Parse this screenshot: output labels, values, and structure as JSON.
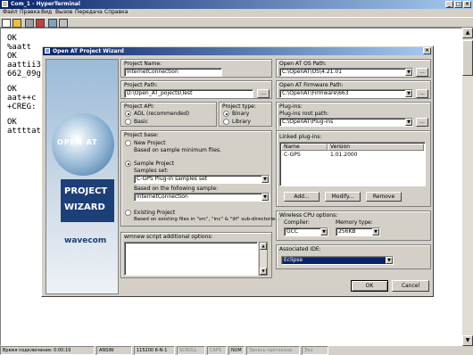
{
  "app": {
    "title": "Com_1 - HyperTerminal",
    "menu": [
      "Файл",
      "Правка",
      "Вид",
      "Вызов",
      "Передача",
      "Справка"
    ]
  },
  "terminal": {
    "lines": [
      "OK",
      "%aatt",
      "OK",
      "aattii3",
      "662_09g",
      "",
      "OK",
      "aat++c",
      "+CREG:",
      "",
      "OK",
      "attttat"
    ]
  },
  "status_bar": {
    "cells": [
      "Время подключения: 0:00:19",
      "ANSIW",
      "115200 8-N-1",
      "SCROLL",
      "CAPS",
      "NUM",
      "Запись протокола",
      "Эхо"
    ]
  },
  "wizard": {
    "title": "Open AT Project Wizard",
    "side_panel": {
      "open_at": "OPEN AT",
      "project": "PROJECT",
      "wizard": "WIZARD",
      "brand": "wavecom"
    },
    "project_name": {
      "label": "Project Name:",
      "value": "InternetConnection"
    },
    "project_path": {
      "label": "Project Path:",
      "value": "D:\\Open_AT_pojects\\Test",
      "browse": "..."
    },
    "project_api": {
      "label": "Project API:",
      "options": [
        "ADL (recommended)",
        "Basic"
      ],
      "selected": 0
    },
    "project_type": {
      "label": "Project type:",
      "options": [
        "Binary",
        "Library"
      ],
      "selected": 0
    },
    "project_base": {
      "label": "Project base:",
      "new_project": "New Project",
      "new_desc": "Based on sample minimum files.",
      "sample_project": "Sample Project",
      "samples_set_label": "Samples set:",
      "samples_set_value": "C-GPS Plug-in samples set",
      "following_sample_label": "Based on the following sample:",
      "following_sample_value": "InternetConnection",
      "existing_project": "Existing Project",
      "existing_desc": "Based on existing files in \"src\", \"inc\" & \"itf\" sub-directories.",
      "selected": 1
    },
    "wmnew": {
      "label": "wmnew script additional options:"
    },
    "os_path": {
      "label": "Open AT OS Path:",
      "value": "C:\\OpenAT\\OS\\4.21.01",
      "browse": "..."
    },
    "fw_path": {
      "label": "Open AT Firmware Path:",
      "value": "C:\\OpenAT\\Firmware\\663",
      "browse": "..."
    },
    "plugins": {
      "label": "Plug-ins:",
      "root_label": "Plug-ins root path:",
      "root_value": "C:\\OpenAT\\Plug-ins",
      "browse": "...",
      "linked_label": "Linked plug-ins:",
      "columns": [
        "Name",
        "Version"
      ],
      "rows": [
        {
          "name": "C-GPS",
          "version": "1.01.2000"
        }
      ],
      "add": "Add...",
      "modify": "Modify...",
      "remove": "Remove"
    },
    "cpu": {
      "label": "Wireless CPU options:",
      "compiler_label": "Compiler:",
      "compiler_value": "GCC",
      "memory_label": "Memory type:",
      "memory_value": "256KB"
    },
    "ide": {
      "label": "Associated IDE:",
      "value": "Eclipse"
    },
    "ok": "OK",
    "cancel": "Cancel"
  },
  "colors": {
    "title_bar": "#0a246a",
    "window_bg": "#d4d0c8",
    "selection": "#0a246a"
  }
}
